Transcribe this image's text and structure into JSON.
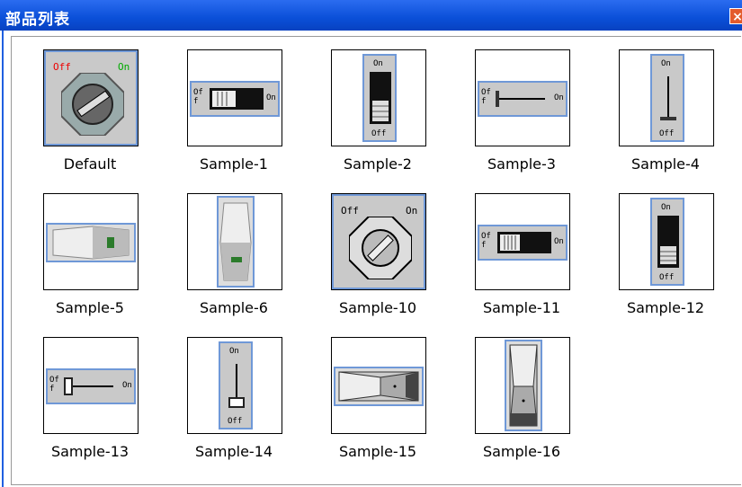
{
  "window": {
    "title": "部品列表",
    "close_icon": "close-icon"
  },
  "items": [
    {
      "label": "Default",
      "icon": "rotary-switch-icon"
    },
    {
      "label": "Sample-1",
      "icon": "slide-switch-horizontal-icon"
    },
    {
      "label": "Sample-2",
      "icon": "rocker-switch-vertical-icon"
    },
    {
      "label": "Sample-3",
      "icon": "lever-switch-horizontal-icon"
    },
    {
      "label": "Sample-4",
      "icon": "lever-switch-vertical-icon"
    },
    {
      "label": "Sample-5",
      "icon": "rocker-panel-horizontal-icon"
    },
    {
      "label": "Sample-6",
      "icon": "rocker-panel-vertical-icon"
    },
    {
      "label": "Sample-10",
      "icon": "rotary-switch-icon"
    },
    {
      "label": "Sample-11",
      "icon": "slide-switch-horizontal-icon"
    },
    {
      "label": "Sample-12",
      "icon": "slide-switch-vertical-icon"
    },
    {
      "label": "Sample-13",
      "icon": "lever-switch-horizontal-icon"
    },
    {
      "label": "Sample-14",
      "icon": "lever-switch-vertical-icon"
    },
    {
      "label": "Sample-15",
      "icon": "rocker-3d-horizontal-icon"
    },
    {
      "label": "Sample-16",
      "icon": "rocker-3d-vertical-icon"
    }
  ],
  "texts": {
    "off": "Off",
    "on": "On",
    "off_lower": "Off",
    "of_f": "Of f"
  }
}
